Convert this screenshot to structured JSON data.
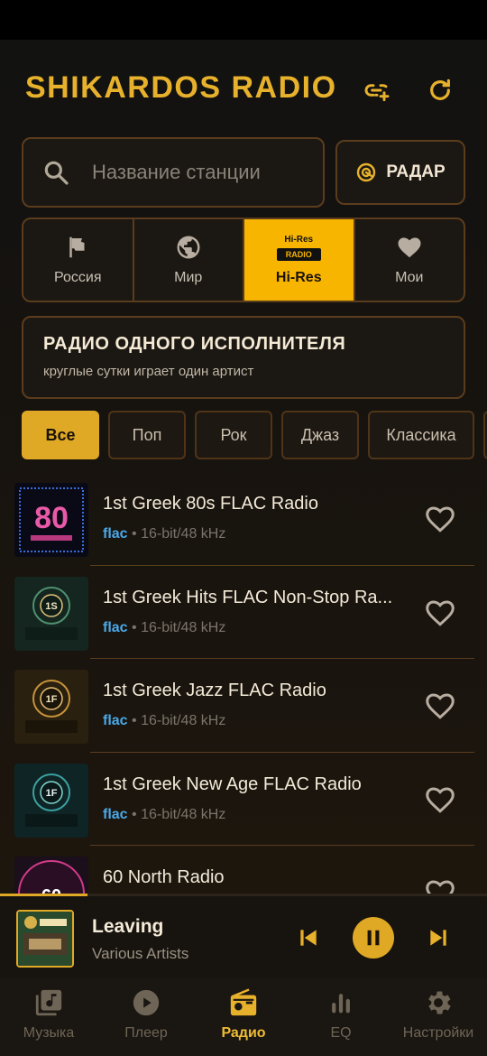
{
  "header": {
    "title": "SHIKARDOS RADIO",
    "add_link_icon": "link-plus-icon",
    "refresh_icon": "refresh-icon"
  },
  "search": {
    "placeholder": "Название станции",
    "value": ""
  },
  "radar": {
    "label": "РАДАР",
    "icon": "radar-icon"
  },
  "categories": [
    {
      "label": "Россия",
      "icon": "flag-icon",
      "active": false
    },
    {
      "label": "Мир",
      "icon": "globe-icon",
      "active": false
    },
    {
      "label": "Hi-Res",
      "icon": "hires-radio-logo",
      "logo_top": "Hi-Res",
      "logo_bottom": "RADIO",
      "active": true
    },
    {
      "label": "Мои",
      "icon": "heart-icon",
      "active": false
    }
  ],
  "banner": {
    "title": "РАДИО ОДНОГО ИСПОЛНИТЕЛЯ",
    "subtitle": "круглые сутки играет один артист"
  },
  "genres": [
    {
      "label": "Все",
      "active": true
    },
    {
      "label": "Поп",
      "active": false
    },
    {
      "label": "Рок",
      "active": false
    },
    {
      "label": "Джаз",
      "active": false
    },
    {
      "label": "Классика",
      "active": false
    }
  ],
  "stations": [
    {
      "name": "1st Greek 80s FLAC Radio",
      "codec": "flac",
      "format": "• 16-bit/48 kHz",
      "cover": "greek-80s-cover",
      "cover_text": "80"
    },
    {
      "name": "1st Greek Hits FLAC Non-Stop Ra...",
      "codec": "flac",
      "format": "• 16-bit/48 kHz",
      "cover": "greek-hits-cover",
      "cover_text": "1S"
    },
    {
      "name": "1st Greek Jazz FLAC Radio",
      "codec": "flac",
      "format": "• 16-bit/48 kHz",
      "cover": "greek-jazz-cover",
      "cover_text": "1F"
    },
    {
      "name": "1st Greek New Age FLAC Radio",
      "codec": "flac",
      "format": "• 16-bit/48 kHz",
      "cover": "greek-newage-cover",
      "cover_text": "1F"
    },
    {
      "name": "60 North Radio",
      "codec": "",
      "format": "",
      "cover": "60-north-cover",
      "cover_text": "60"
    }
  ],
  "player": {
    "title": "Leaving",
    "artist": "Various Artists",
    "progress": 0.18,
    "state": "playing"
  },
  "nav": [
    {
      "label": "Музыка",
      "icon": "music-library-icon",
      "active": false
    },
    {
      "label": "Плеер",
      "icon": "play-circle-icon",
      "active": false
    },
    {
      "label": "Радио",
      "icon": "radio-icon",
      "active": true
    },
    {
      "label": "EQ",
      "icon": "equalizer-icon",
      "active": false
    },
    {
      "label": "Настройки",
      "icon": "settings-gear-icon",
      "active": false
    }
  ],
  "colors": {
    "accent": "#e7b12c",
    "active_tab": "#f7b500",
    "border": "#5b3c1d",
    "codec": "#4aa9e8"
  }
}
